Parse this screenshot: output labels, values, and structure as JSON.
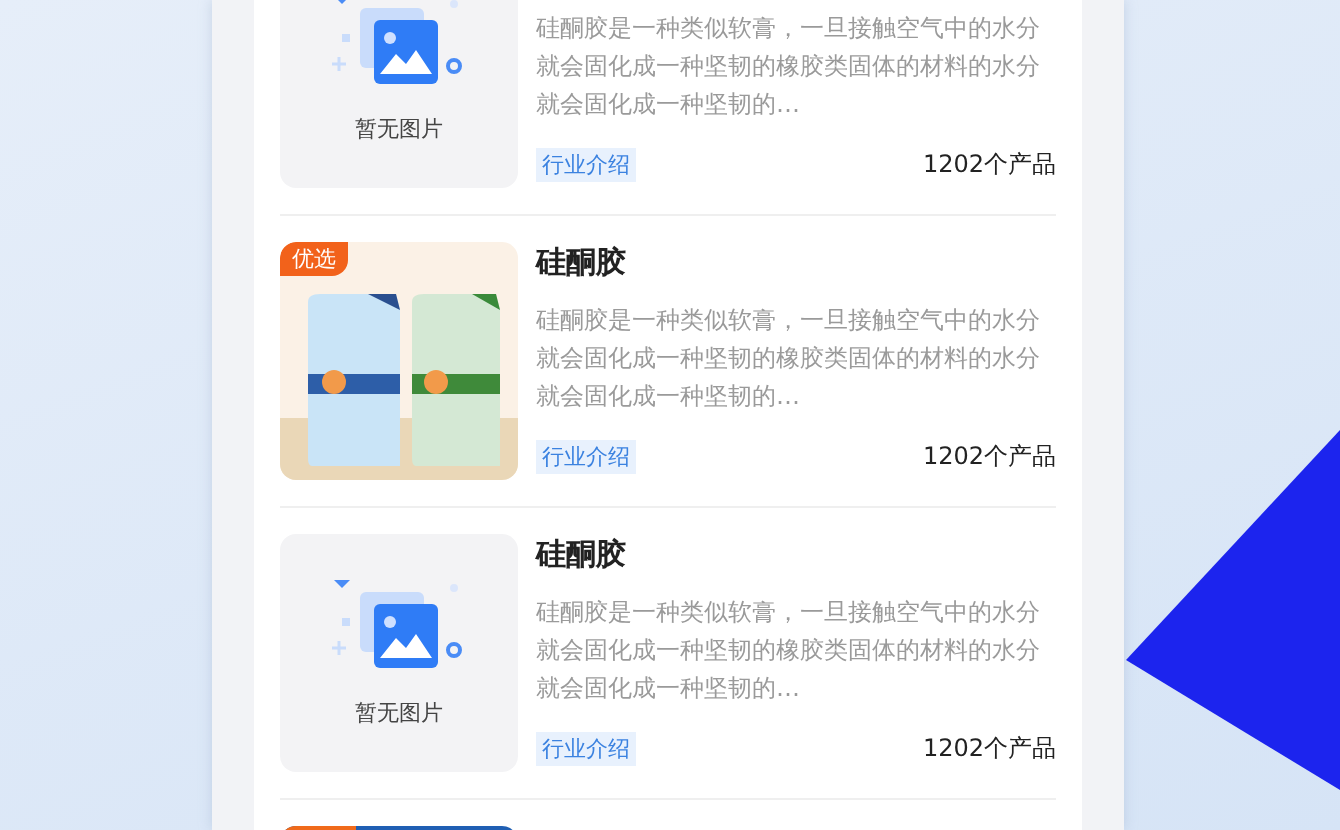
{
  "products": [
    {
      "image": {
        "kind": "placeholder",
        "caption": "暂无图片"
      },
      "description": "硅酮胶是一种类似软膏，一旦接触空气中的水分就会固化成一种坚韧的橡胶类固体的材料的水分就会固化成一种坚韧的…",
      "tag": "行业介绍",
      "count": "1202个产品"
    },
    {
      "image": {
        "kind": "picture",
        "badge": "优选"
      },
      "title": "硅酮胶",
      "description": "硅酮胶是一种类似软膏，一旦接触空气中的水分就会固化成一种坚韧的橡胶类固体的材料的水分就会固化成一种坚韧的…",
      "tag": "行业介绍",
      "count": "1202个产品"
    },
    {
      "image": {
        "kind": "placeholder",
        "caption": "暂无图片"
      },
      "title": "硅酮胶",
      "description": "硅酮胶是一种类似软膏，一旦接触空气中的水分就会固化成一种坚韧的橡胶类固体的材料的水分就会固化成一种坚韧的…",
      "tag": "行业介绍",
      "count": "1202个产品"
    },
    {
      "image": {
        "kind": "stripe"
      }
    }
  ]
}
